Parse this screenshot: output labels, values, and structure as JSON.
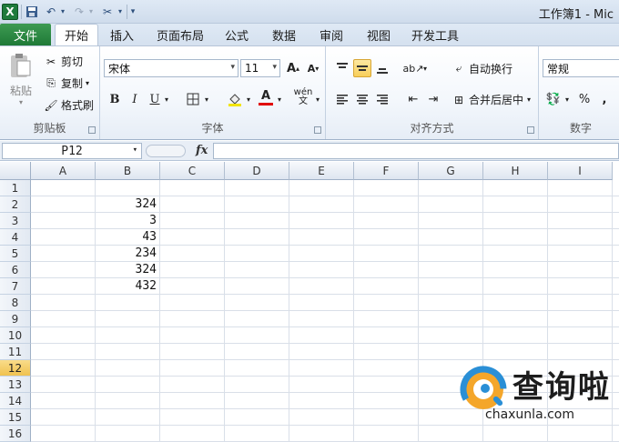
{
  "title": "工作簿1 - Mic",
  "tabs": [
    "文件",
    "开始",
    "插入",
    "页面布局",
    "公式",
    "数据",
    "审阅",
    "视图",
    "开发工具"
  ],
  "ribbon": {
    "clipboard": {
      "paste": "粘贴",
      "cut": "剪切",
      "copy": "复制",
      "format_painter": "格式刷",
      "label": "剪贴板"
    },
    "font": {
      "name": "宋体",
      "size": "11",
      "label": "字体",
      "bold": "B",
      "italic": "I",
      "underline": "U",
      "wen": "wén"
    },
    "alignment": {
      "wrap": "自动换行",
      "merge": "合并后居中",
      "label": "对齐方式"
    },
    "number": {
      "format": "常规",
      "percent": "%",
      "comma": ",",
      "label": "数字"
    }
  },
  "formula_bar": {
    "name_box": "P12",
    "fx": "fx",
    "value": ""
  },
  "columns": [
    "A",
    "B",
    "C",
    "D",
    "E",
    "F",
    "G",
    "H",
    "I"
  ],
  "rows": [
    "1",
    "2",
    "3",
    "4",
    "5",
    "6",
    "7",
    "8",
    "9",
    "10",
    "11",
    "12",
    "13",
    "14",
    "15",
    "16"
  ],
  "active_row": "12",
  "cells": {
    "B2": "324",
    "B3": "3",
    "B4": "43",
    "B5": "234",
    "B6": "324",
    "B7": "432"
  },
  "watermark": {
    "brand": "查询啦",
    "url": "chaxunla.com"
  }
}
